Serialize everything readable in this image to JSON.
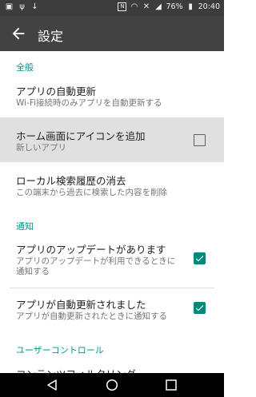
{
  "status": {
    "battery": "76%",
    "time": "20:40"
  },
  "appbar": {
    "title": "設定"
  },
  "sections": {
    "general": "全般",
    "notifications": "通知",
    "user_control": "ユーザーコントロール"
  },
  "items": [
    {
      "title": "アプリの自動更新",
      "subtitle": "Wi-Fi接続時のみアプリを自動更新する"
    },
    {
      "title": "ホーム画面にアイコンを追加",
      "subtitle": "新しいアプリ",
      "checked": false
    },
    {
      "title": "ローカル検索履歴の消去",
      "subtitle": "この端末から過去に検索した内容を削除"
    },
    {
      "title": "アプリのアップデートがあります",
      "subtitle_line1": "アプリのアップデートが利用できるときに",
      "subtitle_line2": "通知する",
      "checked": true
    },
    {
      "title": "アプリが自動更新されました",
      "subtitle": "アプリが自動更新されたときに通知する",
      "checked": true
    },
    {
      "title": "コンテンツフィルタリング"
    }
  ],
  "colors": {
    "accent": "#009688",
    "appbar": "#424242",
    "statusbar": "#3c3c3c",
    "highlight": "#e0e0e0"
  }
}
